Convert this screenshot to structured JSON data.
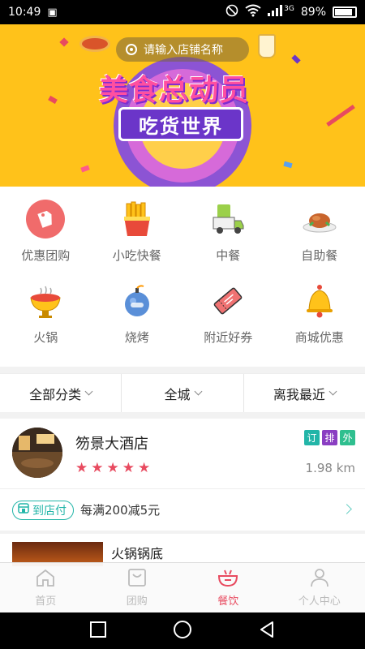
{
  "status_bar": {
    "time": "10:49",
    "network": "3G",
    "battery": "89%"
  },
  "banner": {
    "search_placeholder": "请输入店铺名称",
    "title": "美食总动员",
    "subtitle": "吃货世界"
  },
  "categories": [
    {
      "label": "优惠团购",
      "icon": "discount-tag-icon"
    },
    {
      "label": "小吃快餐",
      "icon": "fries-icon"
    },
    {
      "label": "中餐",
      "icon": "delivery-truck-icon"
    },
    {
      "label": "自助餐",
      "icon": "roast-dish-icon"
    },
    {
      "label": "火锅",
      "icon": "hotpot-icon"
    },
    {
      "label": "烧烤",
      "icon": "bbq-bomb-icon"
    },
    {
      "label": "附近好券",
      "icon": "coupon-ticket-icon"
    },
    {
      "label": "商城优惠",
      "icon": "bell-icon"
    }
  ],
  "filters": [
    {
      "label": "全部分类"
    },
    {
      "label": "全城"
    },
    {
      "label": "离我最近"
    }
  ],
  "shop": {
    "name": "笏景大酒店",
    "rating": 5,
    "distance": "1.98 km",
    "tags": [
      {
        "label": "订",
        "color": "#22b5a8"
      },
      {
        "label": "排",
        "color": "#8a3ec2"
      },
      {
        "label": "外",
        "color": "#2fbf8f"
      }
    ],
    "pay_badge": "到店付",
    "promo": "每满200减5元"
  },
  "dish": {
    "name": "火锅锅底"
  },
  "tabs": [
    {
      "label": "首页",
      "icon": "home-icon"
    },
    {
      "label": "团购",
      "icon": "shopping-bag-icon"
    },
    {
      "label": "餐饮",
      "icon": "dining-icon",
      "active": true
    },
    {
      "label": "个人中心",
      "icon": "person-icon"
    }
  ],
  "colors": {
    "accent": "#e84a5f",
    "teal": "#22b5a8",
    "banner": "#ffc21a"
  }
}
